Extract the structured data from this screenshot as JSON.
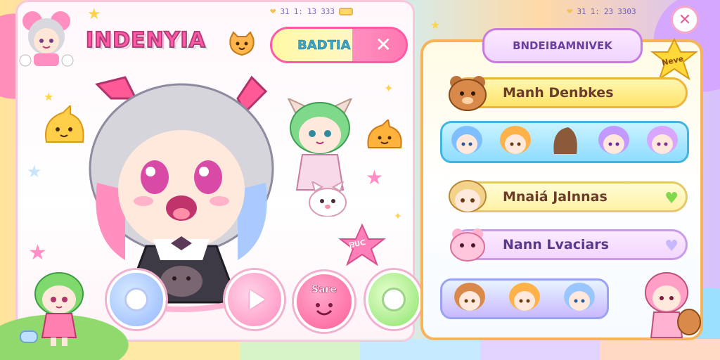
{
  "game": {
    "title": "INDENYIA"
  },
  "status_bar_left": {
    "time": "31",
    "signal": "1:",
    "label_a": "13",
    "label_b": "333"
  },
  "status_bar_right": {
    "time": "31",
    "signal": "1:",
    "label": "23",
    "label_b": "3303"
  },
  "top_pill": {
    "label": "BADTIA",
    "close_glyph": "✕"
  },
  "left_buttons": {
    "save_label": "Sare"
  },
  "stamp": {
    "label": "ᗷᑌᑕ"
  },
  "right_panel": {
    "header": "BNDEIBAMNIVEK",
    "close_glyph": "✕",
    "new_badge": "Neve",
    "rows": [
      {
        "label": "Manh Denbkes"
      },
      {
        "label": "Mnaiá Jalnnas"
      },
      {
        "label": "Nann Lvaciars"
      }
    ]
  },
  "colors": {
    "accent_pink": "#ff5aa5",
    "accent_orange": "#f5b45a",
    "accent_purple": "#c77be0",
    "accent_blue": "#41b6e0",
    "accent_green": "#8be36a"
  }
}
